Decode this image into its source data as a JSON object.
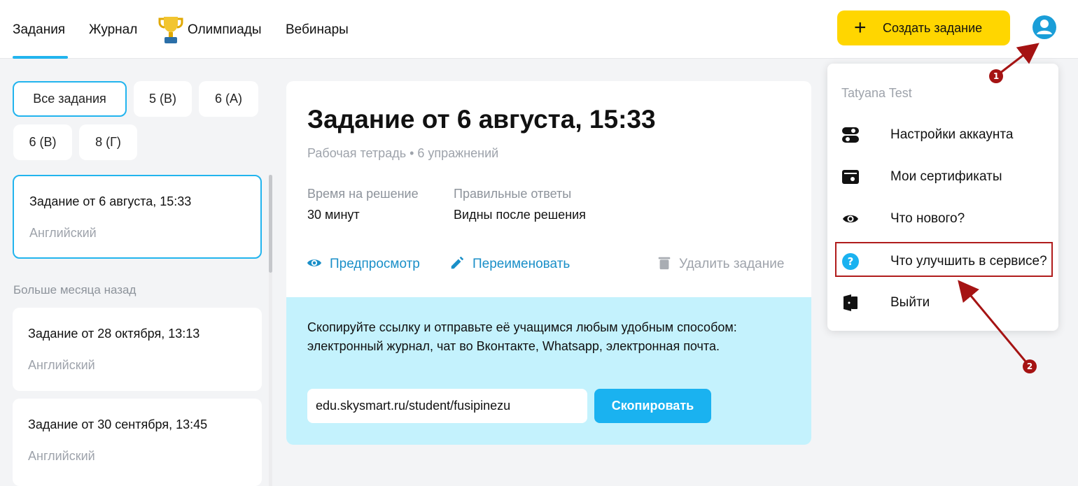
{
  "nav": {
    "items": [
      "Задания",
      "Журнал",
      "Олимпиады",
      "Вебинары"
    ],
    "create_button": "Создать задание"
  },
  "filters": [
    "Все задания",
    "5 (В)",
    "6 (А)",
    "6 (В)",
    "8 (Г)"
  ],
  "task_list": {
    "current": {
      "title": "Задание от 6 августа, 15:33",
      "subject": "Английский"
    },
    "older_section": "Больше месяца назад",
    "older": [
      {
        "title": "Задание от 28 октября, 13:13",
        "subject": "Английский"
      },
      {
        "title": "Задание от 30 сентября, 13:45",
        "subject": "Английский"
      }
    ]
  },
  "task": {
    "title": "Задание от 6 августа, 15:33",
    "subtitle": "Рабочая тетрадь • 6 упражнений",
    "time_label": "Время на решение",
    "time_value": "30 минут",
    "answers_label": "Правильные ответы",
    "answers_value": "Видны после решения",
    "actions": {
      "preview": "Предпросмотр",
      "rename": "Переименовать",
      "delete": "Удалить задание"
    },
    "share_text": "Скопируйте ссылку и отправьте её учащимся любым удобным способом: электронный журнал, чат во Вконтакте, Whatsapp, электронная почта.",
    "link": "edu.skysmart.ru/student/fusipinezu",
    "copy_button": "Скопировать"
  },
  "menu": {
    "user": "Tatyana Test",
    "items": [
      {
        "label": "Настройки аккаунта",
        "icon": "toggle-icon"
      },
      {
        "label": "Мои сертификаты",
        "icon": "certificate-icon"
      },
      {
        "label": "Что нового?",
        "icon": "eye-icon"
      },
      {
        "label": "Что улучшить в сервисе?",
        "icon": "question-icon"
      },
      {
        "label": "Выйти",
        "icon": "logout-icon"
      }
    ]
  },
  "annotations": [
    "1",
    "2"
  ],
  "colors": {
    "accent": "#22b4ee",
    "create": "#ffd600",
    "share_bg": "#c4f2fd",
    "annotation": "#a51313"
  }
}
